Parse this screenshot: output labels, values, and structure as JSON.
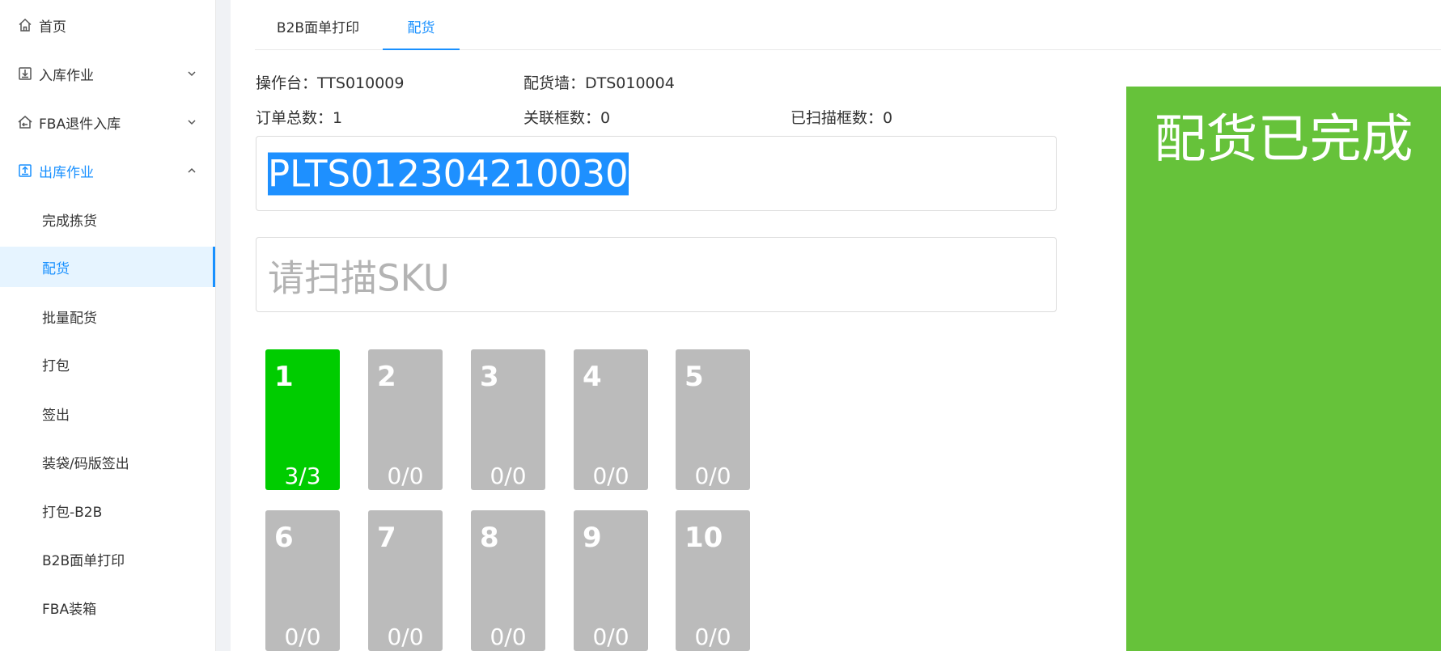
{
  "sidebar": {
    "items": [
      {
        "label": "首页",
        "icon": "home-icon"
      },
      {
        "label": "入库作业",
        "icon": "inbound-icon"
      },
      {
        "label": "FBA退件入库",
        "icon": "return-home-icon"
      },
      {
        "label": "出库作业",
        "icon": "outbound-icon"
      },
      {
        "label": "完成拣货"
      },
      {
        "label": "配货"
      },
      {
        "label": "批量配货"
      },
      {
        "label": "打包"
      },
      {
        "label": "签出"
      },
      {
        "label": "装袋/码版签出"
      },
      {
        "label": "打包-B2B"
      },
      {
        "label": "B2B面单打印"
      },
      {
        "label": "FBA装箱"
      }
    ]
  },
  "tabs": [
    {
      "label": "B2B面单打印"
    },
    {
      "label": "配货"
    }
  ],
  "info": {
    "workstation": "操作台：TTS010009",
    "wall": "配货墙：DTS010004",
    "order_total": "订单总数：1",
    "linked_boxes": "关联框数：0",
    "scanned_boxes": "已扫描框数：0"
  },
  "scan": {
    "value": "PLTS012304210030",
    "sku_placeholder": "请扫描SKU"
  },
  "slots": [
    {
      "num": "1",
      "count": "3/3"
    },
    {
      "num": "2",
      "count": "0/0"
    },
    {
      "num": "3",
      "count": "0/0"
    },
    {
      "num": "4",
      "count": "0/0"
    },
    {
      "num": "5",
      "count": "0/0"
    },
    {
      "num": "6",
      "count": "0/0"
    },
    {
      "num": "7",
      "count": "0/0"
    },
    {
      "num": "8",
      "count": "0/0"
    },
    {
      "num": "9",
      "count": "0/0"
    },
    {
      "num": "10",
      "count": "0/0"
    }
  ],
  "status": {
    "text": "配货已完成"
  },
  "colors": {
    "accent": "#1890ff",
    "slot_done": "#00cc00",
    "slot_empty": "#bbbbbb",
    "status_bg": "#66c23a",
    "selection": "#1e90ff"
  }
}
